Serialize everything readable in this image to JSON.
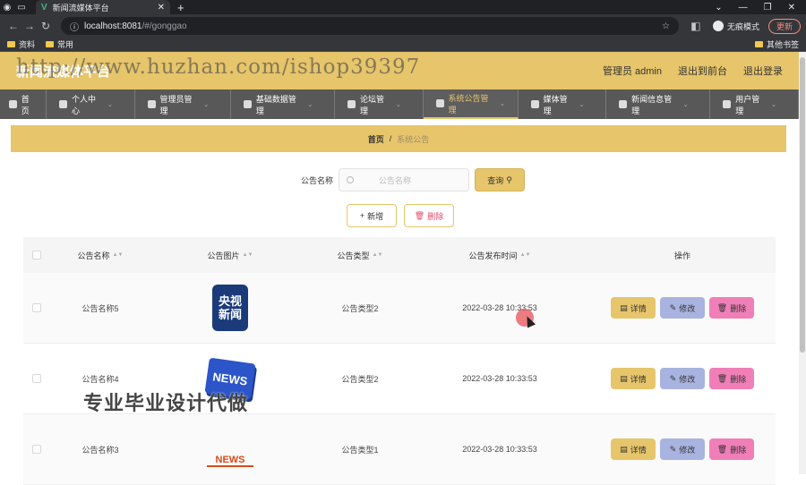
{
  "browser": {
    "tab_title": "新闻流媒体平台",
    "url_host": "localhost:8081",
    "url_path": "/#/gonggao",
    "incognito": "无痕模式",
    "update": "更新",
    "bookmarks": [
      "资料",
      "常用"
    ],
    "bookmarks_right": "其他书签"
  },
  "header": {
    "title": "新闻流媒体平台",
    "watermark": "http://www.huzhan.com/ishop39397",
    "user": "管理员 admin",
    "front": "退出到前台",
    "logout": "退出登录"
  },
  "nav": {
    "items": [
      "首页",
      "个人中心",
      "管理员管理",
      "基础数据管理",
      "论坛管理",
      "系统公告管理",
      "媒体管理",
      "新闻信息管理",
      "用户管理"
    ]
  },
  "breadcrumb": {
    "home": "首页",
    "sep": "/",
    "current": "系统公告"
  },
  "search": {
    "label": "公告名称",
    "placeholder": "公告名称",
    "query_btn": "查询"
  },
  "actions": {
    "add": "新增",
    "delete": "删除"
  },
  "table": {
    "headers": [
      "公告名称",
      "公告图片",
      "公告类型",
      "公告发布时间",
      "操作"
    ],
    "rows": [
      {
        "name": "公告名称5",
        "type": "公告类型2",
        "time": "2022-03-28 10:33:53",
        "img_text": [
          "央视",
          "新闻"
        ]
      },
      {
        "name": "公告名称4",
        "type": "公告类型2",
        "time": "2022-03-28 10:33:53",
        "img_text": [
          "NEWS"
        ]
      },
      {
        "name": "公告名称3",
        "type": "公告类型1",
        "time": "2022-03-28 10:33:53",
        "img_text": [
          "NEWS"
        ]
      }
    ],
    "op_detail": "详情",
    "op_edit": "修改",
    "op_delete": "删除"
  },
  "overlay_text": "专业毕业设计代做",
  "colors": {
    "accent": "#e6c56b",
    "nav_bg": "#595858",
    "edit": "#a9b3e0",
    "delete": "#f07fb8"
  }
}
